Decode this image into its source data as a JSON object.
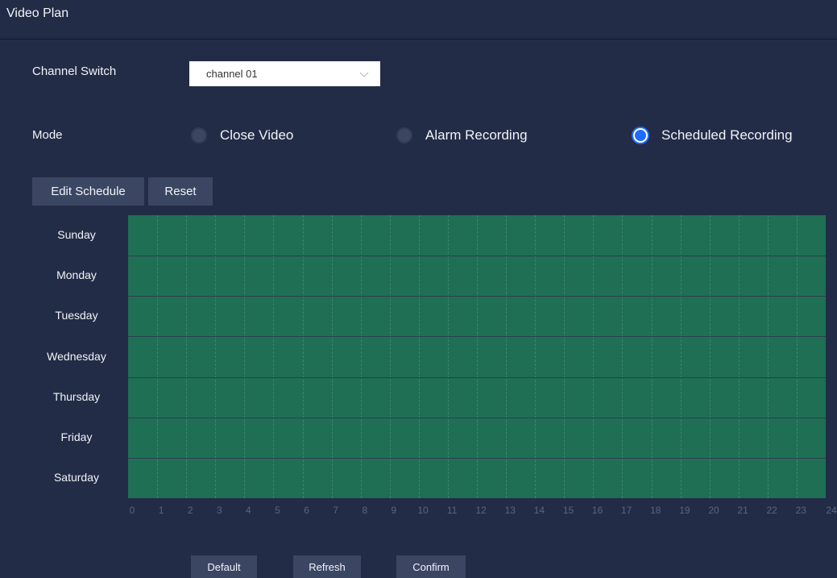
{
  "header": {
    "title": "Video Plan"
  },
  "channel": {
    "label": "Channel Switch",
    "selected": "channel 01"
  },
  "mode": {
    "label": "Mode",
    "options": [
      {
        "label": "Close Video",
        "checked": false
      },
      {
        "label": "Alarm Recording",
        "checked": false
      },
      {
        "label": "Scheduled Recording",
        "checked": true
      }
    ]
  },
  "schedule_buttons": {
    "edit": "Edit Schedule",
    "reset": "Reset"
  },
  "days": [
    "Sunday",
    "Monday",
    "Tuesday",
    "Wednesday",
    "Thursday",
    "Friday",
    "Saturday"
  ],
  "hours": [
    "0",
    "1",
    "2",
    "3",
    "4",
    "5",
    "6",
    "7",
    "8",
    "9",
    "10",
    "11",
    "12",
    "13",
    "14",
    "15",
    "16",
    "17",
    "18",
    "19",
    "20",
    "21",
    "22",
    "23",
    "24"
  ],
  "schedule_fill_color": "#1f6f55",
  "footer": {
    "default": "Default",
    "refresh": "Refresh",
    "confirm": "Confirm"
  }
}
